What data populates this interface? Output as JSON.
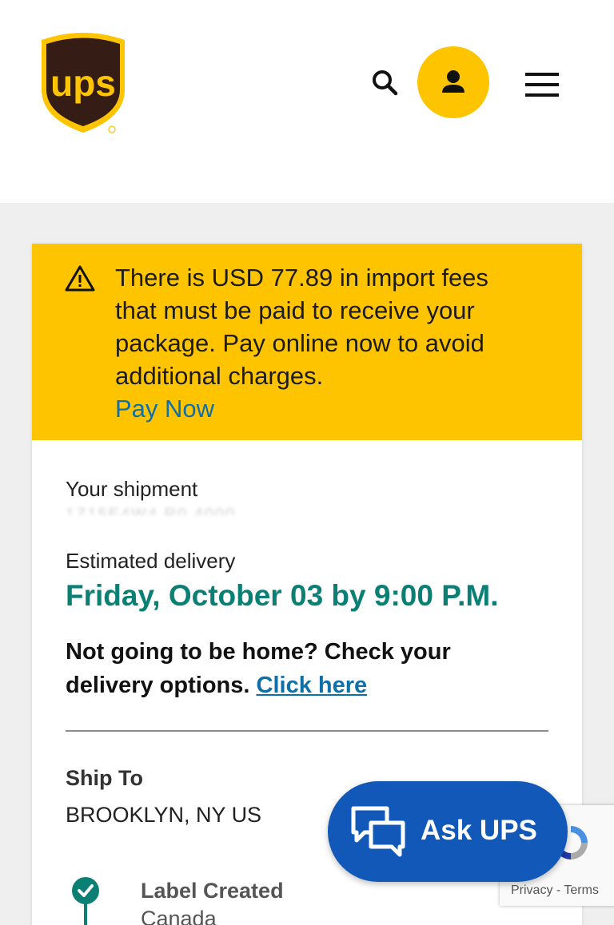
{
  "header": {
    "logo_text": "ups",
    "search_icon": "search-icon",
    "profile_icon": "user-icon",
    "menu_icon": "hamburger-menu-icon",
    "brand_colors": {
      "brown": "#351c15",
      "gold": "#ffc400"
    }
  },
  "alert": {
    "icon": "warning-triangle-icon",
    "message": "There is USD 77.89 in import fees that must be paid to receive your package. Pay online now to avoid additional charges.",
    "link_label": "Pay Now",
    "background": "#ffc400"
  },
  "shipment": {
    "label": "Your shipment",
    "tracking_number": "1Z15E4W4 R0 4000"
  },
  "delivery": {
    "label": "Estimated delivery",
    "date_text": "Friday, October 03 by 9:00 P.M.",
    "not_home_text": "Not going to be home? Check your delivery options.",
    "click_here_label": "Click here"
  },
  "ship_to": {
    "label": "Ship To",
    "value": "BROOKLYN, NY US"
  },
  "timeline": {
    "events": [
      {
        "title": "Label Created",
        "location": "Canada",
        "icon": "check-icon"
      }
    ]
  },
  "chat": {
    "label": "Ask UPS",
    "icon": "chat-bubbles-icon"
  },
  "recaptcha": {
    "privacy": "Privacy",
    "separator": "-",
    "terms": "Terms"
  }
}
